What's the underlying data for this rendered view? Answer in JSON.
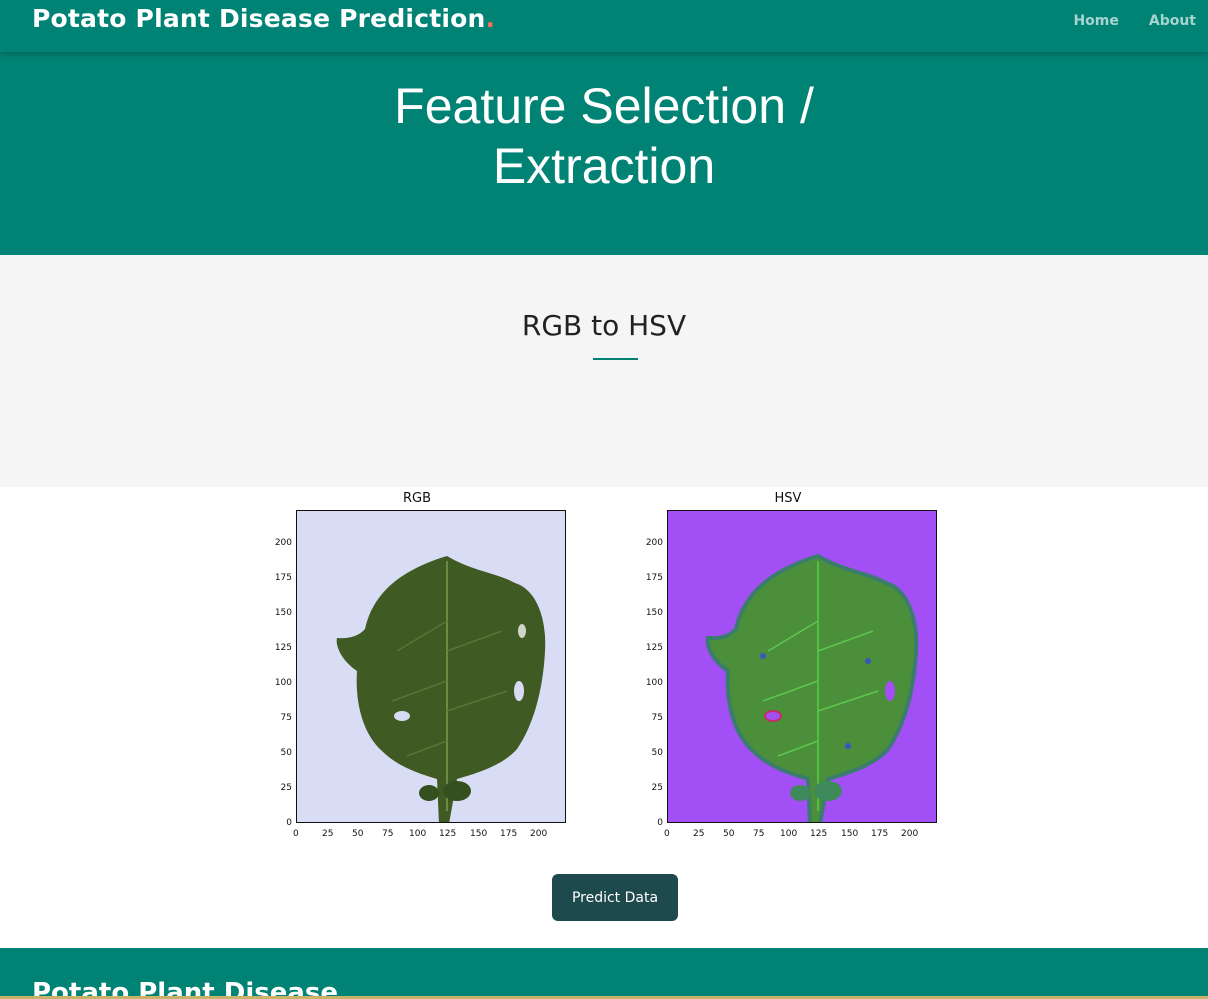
{
  "header": {
    "brand": "Potato Plant Disease Prediction",
    "brand_dot": ".",
    "nav": [
      "Home",
      "About"
    ]
  },
  "hero": {
    "title": "Feature Selection / Extraction"
  },
  "section": {
    "title": "RGB to HSV"
  },
  "figures": [
    {
      "title": "RGB",
      "yticks": [
        "200",
        "175",
        "150",
        "125",
        "100",
        "75",
        "50",
        "25",
        "0"
      ],
      "xticks": [
        "0",
        "25",
        "50",
        "75",
        "100",
        "125",
        "150",
        "175",
        "200"
      ]
    },
    {
      "title": "HSV",
      "yticks": [
        "200",
        "175",
        "150",
        "125",
        "100",
        "75",
        "50",
        "25",
        "0"
      ],
      "xticks": [
        "0",
        "25",
        "50",
        "75",
        "100",
        "125",
        "150",
        "175",
        "200"
      ]
    }
  ],
  "button": {
    "label": "Predict Data"
  },
  "footer": {
    "brand": "Potato Plant Disease"
  },
  "colors": {
    "primary": "#008374",
    "accent": "#f96f59",
    "button": "#1e4a4d"
  }
}
